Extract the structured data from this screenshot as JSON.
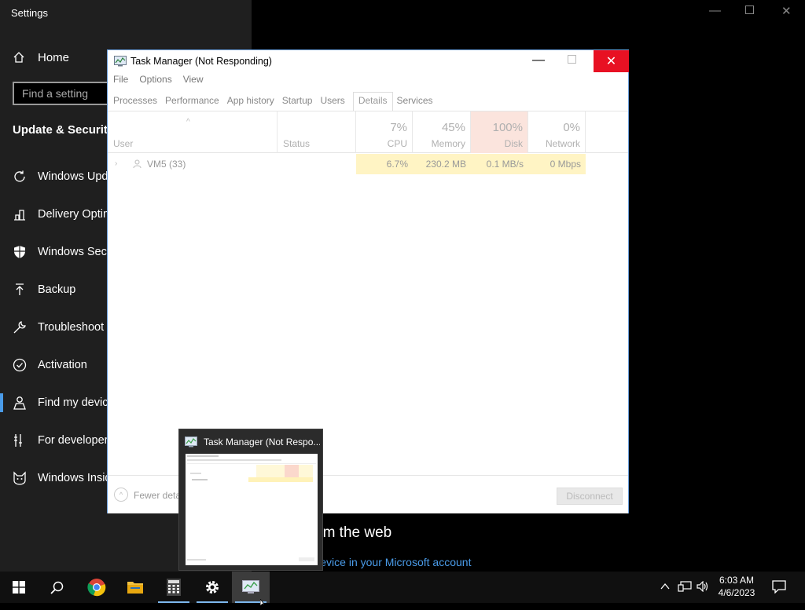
{
  "settings": {
    "window_title": "Settings",
    "home_label": "Home",
    "search_placeholder": "Find a setting",
    "section_title": "Update & Security",
    "nav_items": [
      {
        "label": "Windows Update",
        "icon": "refresh-icon"
      },
      {
        "label": "Delivery Optimization",
        "icon": "delivery-icon"
      },
      {
        "label": "Windows Security",
        "icon": "shield-icon"
      },
      {
        "label": "Backup",
        "icon": "backup-arrow-icon"
      },
      {
        "label": "Troubleshoot",
        "icon": "wrench-icon"
      },
      {
        "label": "Activation",
        "icon": "check-circle-icon"
      },
      {
        "label": "Find my device",
        "icon": "person-pin-icon",
        "selected": true
      },
      {
        "label": "For developers",
        "icon": "developer-tools-icon"
      },
      {
        "label": "Windows Insider Program",
        "icon": "cat-icon"
      }
    ],
    "main": {
      "web_heading": "om the web",
      "link_text": "Manage device in your Microsoft account"
    },
    "accent_color": "#4a9be8"
  },
  "task_manager": {
    "title": "Task Manager (Not Responding)",
    "menu": [
      "File",
      "Options",
      "View"
    ],
    "tabs": [
      "Processes",
      "Performance",
      "App history",
      "Startup",
      "Users",
      "Details",
      "Services"
    ],
    "active_tab": "Details",
    "columns": {
      "user": "User",
      "status": "Status",
      "cpu": {
        "pct": "7%",
        "label": "CPU"
      },
      "memory": {
        "pct": "45%",
        "label": "Memory"
      },
      "disk": {
        "pct": "100%",
        "label": "Disk"
      },
      "network": {
        "pct": "0%",
        "label": "Network"
      }
    },
    "rows": [
      {
        "user": "VM5 (33)",
        "status": "",
        "cpu": "6.7%",
        "memory": "230.2 MB",
        "disk": "0.1 MB/s",
        "network": "0 Mbps"
      }
    ],
    "footer": {
      "fewer_details": "Fewer details",
      "disconnect": "Disconnect"
    },
    "close_color": "#e81123"
  },
  "taskbar_preview": {
    "title": "Task Manager (Not Respo..."
  },
  "taskbar": {
    "apps": [
      "start-icon",
      "search-icon",
      "chrome-icon",
      "file-explorer-icon",
      "calculator-icon",
      "settings-gear-icon",
      "task-manager-icon"
    ],
    "clock_time": "6:03 AM",
    "clock_date": "4/6/2023"
  }
}
